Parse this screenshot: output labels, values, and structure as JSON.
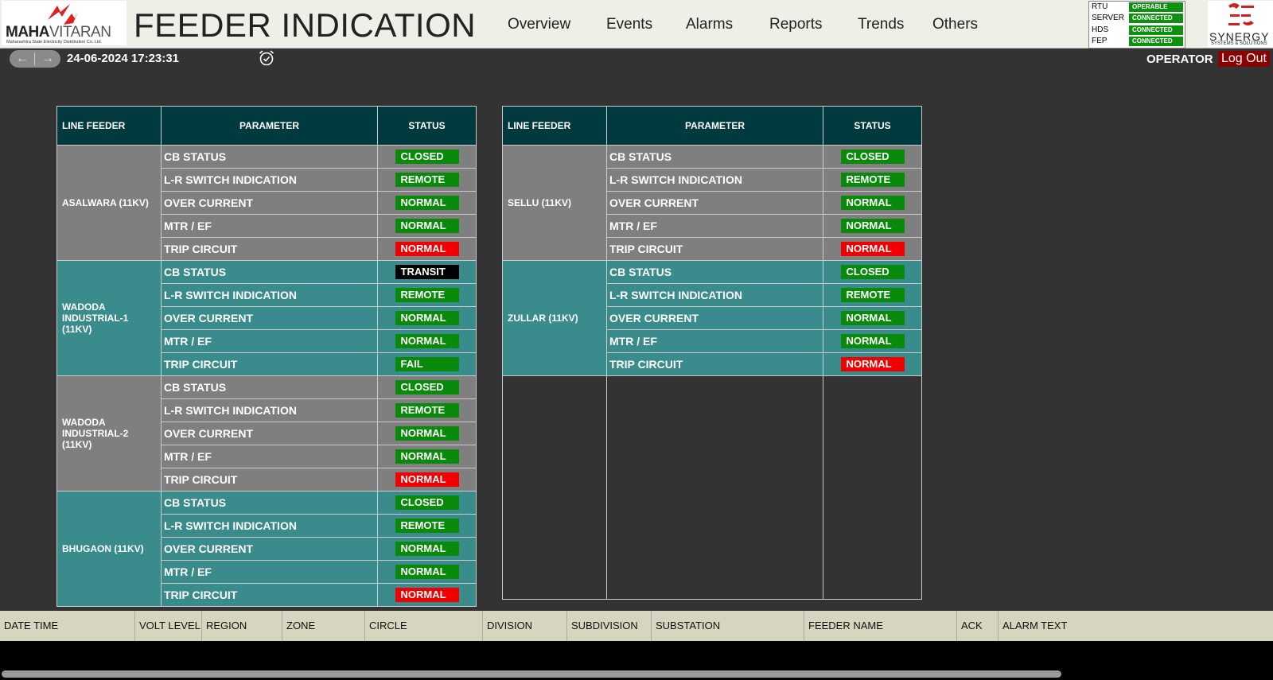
{
  "header": {
    "logo": {
      "name_bold": "MAHA",
      "name_light": "VITARAN",
      "subtitle": "Maharashtra State Electricity Distribution Co. Ltd."
    },
    "title": "FEEDER INDICATION",
    "nav": [
      "Overview",
      "Events",
      "Alarms",
      "Reports",
      "Trends",
      "Others"
    ],
    "system_status": [
      {
        "label": "RTU",
        "value": "OPERABLE"
      },
      {
        "label": "SERVER",
        "value": "CONNECTED"
      },
      {
        "label": "HDS",
        "value": "CONNECTED"
      },
      {
        "label": "FEP",
        "value": "CONNECTED"
      }
    ],
    "vendor": {
      "name": "SYNERGY",
      "subtitle": "SYSTEMS & SOLUTIONS"
    }
  },
  "toolbar": {
    "back_icon": "arrow-left-icon",
    "forward_icon": "arrow-right-icon",
    "datetime": "24-06-2024 17:23:31",
    "alarm_icon": "alarm-clock-icon",
    "user_role": "OPERATOR",
    "logout_label": "Log Out"
  },
  "colors": {
    "header_bg": "#003a3e",
    "row_grey": "#7f7f7f",
    "row_teal": "#3a8c8c",
    "status_green": "#0a8a0a",
    "status_red": "#f00000",
    "status_black": "#000000",
    "logout_bg": "#8b0000"
  },
  "tables": {
    "left": {
      "headers": [
        "LINE FEEDER",
        "PARAMETER",
        "STATUS"
      ],
      "feeders": [
        {
          "name": "ASALWARA (11KV)",
          "rows": [
            {
              "param": "CB STATUS",
              "status": "CLOSED"
            },
            {
              "param": "L-R SWITCH INDICATION",
              "status": "REMOTE"
            },
            {
              "param": "OVER CURRENT",
              "status": "NORMAL"
            },
            {
              "param": "MTR / EF",
              "status": "NORMAL"
            },
            {
              "param": "TRIP CIRCUIT",
              "status": "NORMAL"
            }
          ]
        },
        {
          "name": "WADODA\nINDUSTRIAL-1\n (11KV)",
          "rows": [
            {
              "param": "CB STATUS",
              "status": "TRANSIT"
            },
            {
              "param": "L-R SWITCH INDICATION",
              "status": "REMOTE"
            },
            {
              "param": "OVER CURRENT",
              "status": "NORMAL"
            },
            {
              "param": "MTR / EF",
              "status": "NORMAL"
            },
            {
              "param": "TRIP CIRCUIT",
              "status": "FAIL"
            }
          ]
        },
        {
          "name": "WADODA\nINDUSTRIAL-2\n (11KV)",
          "rows": [
            {
              "param": "CB STATUS",
              "status": "CLOSED"
            },
            {
              "param": "L-R SWITCH INDICATION",
              "status": "REMOTE"
            },
            {
              "param": "OVER CURRENT",
              "status": "NORMAL"
            },
            {
              "param": "MTR / EF",
              "status": "NORMAL"
            },
            {
              "param": "TRIP CIRCUIT",
              "status": "NORMAL"
            }
          ]
        },
        {
          "name": "BHUGAON (11KV)",
          "rows": [
            {
              "param": "CB STATUS",
              "status": "CLOSED"
            },
            {
              "param": "L-R SWITCH INDICATION",
              "status": "REMOTE"
            },
            {
              "param": "OVER CURRENT",
              "status": "NORMAL"
            },
            {
              "param": "MTR / EF",
              "status": "NORMAL"
            },
            {
              "param": "TRIP CIRCUIT",
              "status": "NORMAL"
            }
          ]
        }
      ],
      "badge_colors": [
        [
          "green",
          "green",
          "green",
          "green",
          "red"
        ],
        [
          "black",
          "green",
          "green",
          "green",
          "green"
        ],
        [
          "green",
          "green",
          "green",
          "green",
          "red"
        ],
        [
          "green",
          "green",
          "green",
          "green",
          "red"
        ]
      ]
    },
    "right": {
      "headers": [
        "LINE FEEDER",
        "PARAMETER",
        "STATUS"
      ],
      "feeders": [
        {
          "name": "SELLU (11KV)",
          "rows": [
            {
              "param": "CB STATUS",
              "status": "CLOSED"
            },
            {
              "param": "L-R SWITCH INDICATION",
              "status": "REMOTE"
            },
            {
              "param": "OVER CURRENT",
              "status": "NORMAL"
            },
            {
              "param": "MTR / EF",
              "status": "NORMAL"
            },
            {
              "param": "TRIP CIRCUIT",
              "status": "NORMAL"
            }
          ]
        },
        {
          "name": "ZULLAR (11KV)",
          "rows": [
            {
              "param": "CB STATUS",
              "status": "CLOSED"
            },
            {
              "param": "L-R SWITCH INDICATION",
              "status": "REMOTE"
            },
            {
              "param": "OVER CURRENT",
              "status": "NORMAL"
            },
            {
              "param": "MTR / EF",
              "status": "NORMAL"
            },
            {
              "param": "TRIP CIRCUIT",
              "status": "NORMAL"
            }
          ]
        }
      ],
      "badge_colors": [
        [
          "green",
          "green",
          "green",
          "green",
          "red"
        ],
        [
          "green",
          "green",
          "green",
          "green",
          "red"
        ]
      ]
    }
  },
  "alarm_table": {
    "columns": [
      "DATE TIME",
      "VOLT LEVEL",
      "REGION",
      "ZONE",
      "CIRCLE",
      "DIVISION",
      "SUBDIVISION",
      "SUBSTATION",
      "FEEDER NAME",
      "ACK",
      "ALARM TEXT"
    ]
  }
}
